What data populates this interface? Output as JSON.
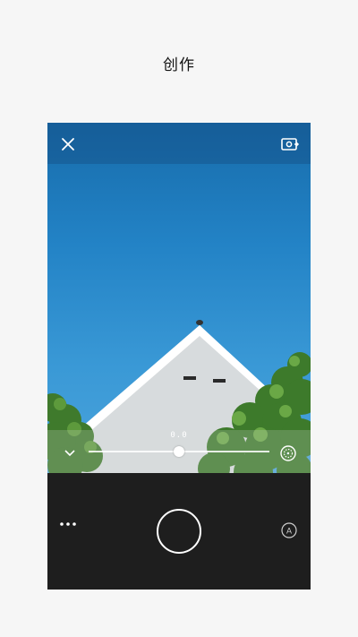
{
  "page": {
    "title": "创作"
  },
  "camera": {
    "exposure_value": "0.0",
    "exposure_level": 0.5,
    "flash_mode_label": "A"
  },
  "icons": {
    "close": "close-icon",
    "flip_camera": "flip-camera-icon",
    "collapse": "chevron-down-icon",
    "timer": "timer-icon",
    "more": "more-icon",
    "shutter": "shutter-icon",
    "flash_auto": "flash-auto-icon"
  },
  "colors": {
    "sky_top": "#176cab",
    "sky_bottom": "#4aa3dc",
    "panel": "#1e1e1e",
    "background": "#f6f6f6"
  }
}
